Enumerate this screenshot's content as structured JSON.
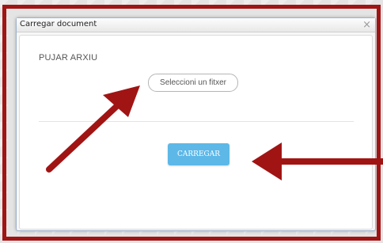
{
  "dialog": {
    "title": "Carregar document",
    "close_symbol": "×"
  },
  "upload": {
    "heading": "PUJAR ARXIU",
    "file_button_label": "Seleccioni un fitxer",
    "submit_label": "CARREGAR"
  },
  "annotations": {
    "color": "#a11414",
    "arrows": [
      "pointer-arrow-to-file-button",
      "pointer-arrow-to-submit-button"
    ]
  }
}
